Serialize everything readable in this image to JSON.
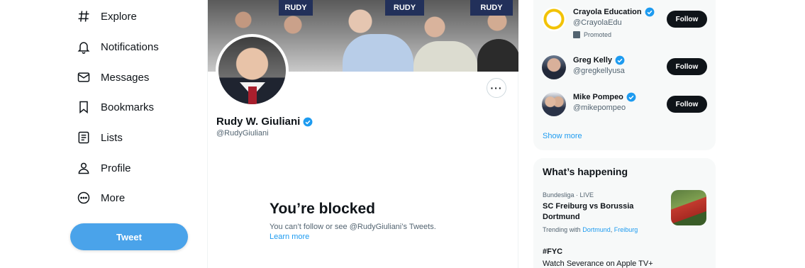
{
  "nav": {
    "items": [
      {
        "label": "Explore",
        "icon": "hashtag-icon"
      },
      {
        "label": "Notifications",
        "icon": "bell-icon"
      },
      {
        "label": "Messages",
        "icon": "envelope-icon"
      },
      {
        "label": "Bookmarks",
        "icon": "bookmark-icon"
      },
      {
        "label": "Lists",
        "icon": "list-icon"
      },
      {
        "label": "Profile",
        "icon": "person-icon"
      },
      {
        "label": "More",
        "icon": "more-circle-icon"
      }
    ],
    "tweet_label": "Tweet"
  },
  "banner": {
    "signs": [
      "RUDY",
      "RUDY",
      "RUDY"
    ]
  },
  "profile": {
    "name": "Rudy W. Giuliani",
    "handle": "@RudyGiuliani",
    "more_label": "···"
  },
  "blocked": {
    "title": "You’re blocked",
    "description": "You can’t follow or see @RudyGiuliani’s Tweets.",
    "link": "Learn more"
  },
  "who_to_follow": {
    "accounts": [
      {
        "name": "Crayola Education",
        "handle": "@CrayolaEdu",
        "promoted": "Promoted",
        "follow_label": "Follow"
      },
      {
        "name": "Greg Kelly",
        "handle": "@gregkellyusa",
        "follow_label": "Follow"
      },
      {
        "name": "Mike Pompeo",
        "handle": "@mikepompeo",
        "follow_label": "Follow"
      }
    ],
    "show_more": "Show more"
  },
  "trends": {
    "heading": "What’s happening",
    "items": [
      {
        "meta": "Bundesliga · LIVE",
        "title": "SC Freiburg vs Borussia Dortmund",
        "trending_with_label": "Trending with",
        "with": [
          "Dortmund",
          "Freiburg"
        ]
      },
      {
        "title": "#FYC",
        "subtitle": "Watch Severance on Apple TV+"
      }
    ]
  },
  "colors": {
    "accent": "#1d9bf0",
    "tweet_button": "#4aa3ea",
    "follow_button": "#0f1419"
  }
}
